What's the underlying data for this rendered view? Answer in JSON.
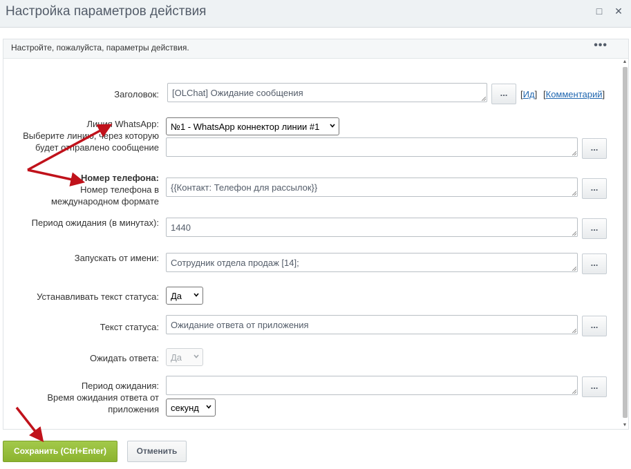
{
  "window": {
    "title": "Настройка параметров действия",
    "maximize_glyph": "□",
    "close_glyph": "✕"
  },
  "panel": {
    "hint": "Настройте, пожалуйста, параметры действия.",
    "more_glyph": "•••"
  },
  "form": {
    "title_label": "Заголовок:",
    "title_value": "[OLChat] Ожидание сообщения",
    "id_link": "Ид",
    "comment_link": "Комментарий",
    "line_label": "Линия WhatsApp:",
    "line_desc_1": "Выберите линию, через которую",
    "line_desc_2": "будет отправлено сообщение",
    "line_value": "№1 - WhatsApp коннектор линии #1",
    "line_extra_value": "",
    "phone_label": "Номер телефона:",
    "phone_desc_1": "Номер телефона в",
    "phone_desc_2": "международном формате",
    "phone_value": "{{Контакт: Телефон для рассылок}}",
    "wait_minutes_label": "Период ожидания (в минутах):",
    "wait_minutes_value": "1440",
    "run_as_label": "Запускать от имени:",
    "run_as_value": "Сотрудник отдела продаж [14];",
    "set_status_label": "Устанавливать текст статуса:",
    "set_status_value": "Да",
    "status_text_label": "Текст статуса:",
    "status_text_value": "Ожидание ответа от приложения",
    "await_reply_label": "Ожидать ответа:",
    "await_reply_value": "Да",
    "wait_period_label": "Период ожидания:",
    "wait_period_desc_1": "Время ожидания ответа от",
    "wait_period_desc_2": "приложения",
    "wait_period_value": "",
    "wait_period_unit": "секунд",
    "dots_label": "..."
  },
  "buttons": {
    "save": "Сохранить (Ctrl+Enter)",
    "cancel": "Отменить"
  },
  "colors": {
    "annotation_arrow": "#c0121b",
    "save_green": "#8bb32f",
    "link_blue": "#2067b0"
  }
}
